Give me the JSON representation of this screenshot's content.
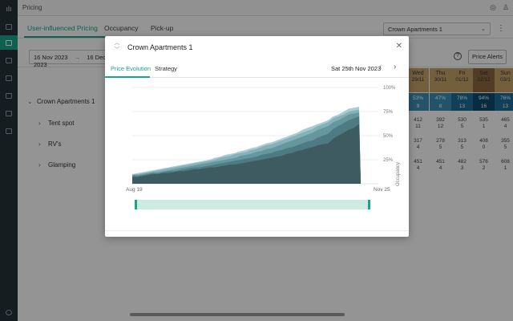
{
  "topbar": {
    "title": "Pricing"
  },
  "tabs": [
    {
      "label": "User-influenced Pricing"
    },
    {
      "label": "Occupancy"
    },
    {
      "label": "Pick-up"
    }
  ],
  "property_select": {
    "value": "Crown Apartments 1"
  },
  "filters": {
    "date_from": "16 Nov 2023",
    "date_to": "16 Dec 2023",
    "arrow": "→",
    "alerts_label": "Price Alerts"
  },
  "tree": [
    {
      "label": "Crown Apartments 1"
    },
    {
      "label": "Tent spot"
    },
    {
      "label": "RV's"
    },
    {
      "label": "Glamping"
    }
  ],
  "days": [
    {
      "name": "Wed",
      "date": "29/11",
      "bg": "#c9a46a"
    },
    {
      "name": "Thu",
      "date": "30/11",
      "bg": "#c9a46a"
    },
    {
      "name": "Fri",
      "date": "01/12",
      "bg": "#c9a46a"
    },
    {
      "name": "Sat",
      "date": "02/12",
      "bg": "#8e6a3e"
    },
    {
      "name": "Sun",
      "date": "03/1",
      "bg": "#c9a46a"
    }
  ],
  "occupancy": [
    {
      "value": "53%",
      "sub": "9",
      "bg": "#3d8fb3"
    },
    {
      "value": "47%",
      "sub": "8",
      "bg": "#3d8fb3"
    },
    {
      "value": "78%",
      "sub": "13",
      "bg": "#1b6f97"
    },
    {
      "value": "94%",
      "sub": "16",
      "bg": "#0d4a6e"
    },
    {
      "value": "76%",
      "sub": "13",
      "bg": "#1b6f97"
    }
  ],
  "rows": [
    [
      {
        "v": "412",
        "s": "11"
      },
      {
        "v": "392",
        "s": "12"
      },
      {
        "v": "530",
        "s": "5"
      },
      {
        "v": "535",
        "s": "1"
      },
      {
        "v": "465",
        "s": "4"
      }
    ],
    [
      {
        "v": "317",
        "s": "4"
      },
      {
        "v": "278",
        "s": "5"
      },
      {
        "v": "313",
        "s": "5"
      },
      {
        "v": "408",
        "s": "0"
      },
      {
        "v": "355",
        "s": "5"
      }
    ],
    [
      {
        "v": "451",
        "s": "4"
      },
      {
        "v": "451",
        "s": "4"
      },
      {
        "v": "482",
        "s": "3"
      },
      {
        "v": "576",
        "s": "2"
      },
      {
        "v": "608",
        "s": "1"
      }
    ]
  ],
  "modal": {
    "title": "Crown Apartments 1",
    "tab_price_evolution": "Price Evolution",
    "tab_strategy": "Strategy",
    "date": "Sat 25th Nov 2023",
    "prev_icon": "chevron-left-icon",
    "next_icon": "chevron-right-icon",
    "close_icon": "close-icon"
  },
  "chart_data": {
    "type": "area",
    "x_start": "Aug 19",
    "x_end": "Nov 25",
    "xlabel": "",
    "ylabel": "Occupancy",
    "y_ticks": [
      "25%",
      "50%",
      "75%",
      "100%"
    ],
    "ylim": [
      0,
      100
    ],
    "grid": true,
    "series": [
      {
        "values": [
          7,
          7,
          8,
          9,
          10,
          10,
          11,
          11,
          12,
          13,
          13,
          14,
          15,
          15,
          16,
          17,
          17,
          18,
          19,
          20,
          20,
          21,
          22,
          23,
          24,
          25,
          26,
          27,
          28,
          29,
          31,
          32,
          34,
          35,
          37,
          38,
          40,
          41,
          42,
          47,
          50,
          53,
          56,
          58,
          62,
          0
        ],
        "color": "#3d5b61"
      },
      {
        "values": [
          8,
          8,
          9,
          10,
          11,
          11,
          12,
          13,
          13,
          14,
          15,
          16,
          17,
          17,
          18,
          19,
          20,
          21,
          22,
          23,
          24,
          25,
          26,
          27,
          28,
          30,
          31,
          32,
          34,
          35,
          37,
          38,
          40,
          42,
          44,
          45,
          48,
          50,
          52,
          57,
          60,
          63,
          66,
          68,
          70,
          0
        ],
        "color": "#4e7b83"
      },
      {
        "values": [
          9,
          9,
          10,
          11,
          12,
          12,
          13,
          14,
          15,
          16,
          17,
          18,
          19,
          20,
          21,
          22,
          23,
          24,
          25,
          26,
          27,
          29,
          30,
          31,
          33,
          34,
          36,
          37,
          39,
          41,
          43,
          45,
          47,
          49,
          51,
          53,
          56,
          58,
          60,
          64,
          66,
          69,
          72,
          73,
          74,
          0
        ],
        "color": "#67979e"
      },
      {
        "values": [
          10,
          10,
          11,
          12,
          13,
          14,
          15,
          16,
          17,
          18,
          19,
          20,
          21,
          22,
          23,
          24,
          25,
          27,
          28,
          29,
          31,
          32,
          33,
          35,
          36,
          38,
          40,
          41,
          43,
          45,
          47,
          49,
          51,
          53,
          55,
          57,
          60,
          62,
          64,
          68,
          70,
          72,
          75,
          76,
          77,
          0
        ],
        "color": "#85b2b8"
      },
      {
        "values": [
          10,
          11,
          12,
          13,
          14,
          15,
          16,
          17,
          18,
          19,
          20,
          21,
          22,
          23,
          24,
          25,
          27,
          28,
          30,
          31,
          32,
          34,
          35,
          37,
          38,
          40,
          42,
          43,
          45,
          47,
          49,
          51,
          53,
          56,
          58,
          60,
          62,
          64,
          66,
          70,
          72,
          75,
          78,
          79,
          80,
          0
        ],
        "color": "#a8cdd1"
      }
    ]
  },
  "colors": {
    "accent": "#1aa58a",
    "rail": "#273238"
  }
}
